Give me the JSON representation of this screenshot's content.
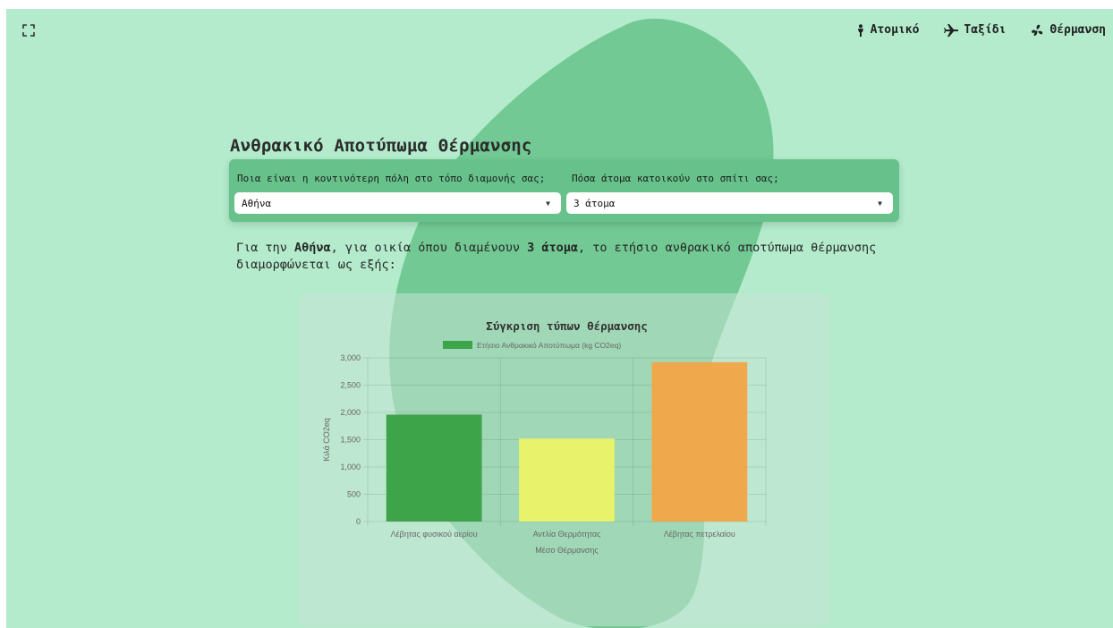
{
  "nav": {
    "items": [
      {
        "label": "Ατομικό",
        "icon": "person-icon"
      },
      {
        "label": "Ταξίδι",
        "icon": "airplane-icon"
      },
      {
        "label": "Θέρμανση",
        "icon": "heating-fan-icon"
      }
    ]
  },
  "page": {
    "title": "Ανθρακικό Αποτύπωμα Θέρμανσης"
  },
  "form": {
    "city_label": "Ποια είναι η κοντινότερη πόλη στο τόπο διαμονής σας;",
    "city_value": "Αθήνα",
    "people_label": "Πόσα άτομα κατοικούν στο σπίτι σας;",
    "people_value": "3 άτομα"
  },
  "result": {
    "part1": "Για την ",
    "city": "Αθήνα",
    "part2": ", για οικία όπου διαμένουν ",
    "people": "3 άτομα",
    "part3": ", το ετήσιο ανθρακικό αποτύπωμα θέρμανσης διαμορφώνεται ως εξής:"
  },
  "colors": {
    "background": "#b3ebcc",
    "blob": "#6cc58e",
    "form_card": "#66c28a"
  },
  "chart_data": {
    "type": "bar",
    "title": "Σύγκριση τύπων θέρμανσης",
    "categories": [
      "Λέβητας φυσικού αερίου",
      "Αντλία Θερμότητας",
      "Λέβητας πετρελαίου"
    ],
    "series": [
      {
        "name": "Ετήσιο Ανθρακικό Αποτύπωμα (kg CO2eq)",
        "values": [
          1960,
          1520,
          2920
        ],
        "colors": [
          "#3da44a",
          "#e8f26a",
          "#f0a84c"
        ]
      }
    ],
    "xlabel": "Μέσο Θέρμανσης",
    "ylabel": "Κιλά CO2eq",
    "ylim": [
      0,
      3000
    ],
    "yticks": [
      "0",
      "500",
      "1,000",
      "1,500",
      "2,000",
      "2,500",
      "3,000"
    ],
    "grid": true,
    "legend": "top"
  }
}
